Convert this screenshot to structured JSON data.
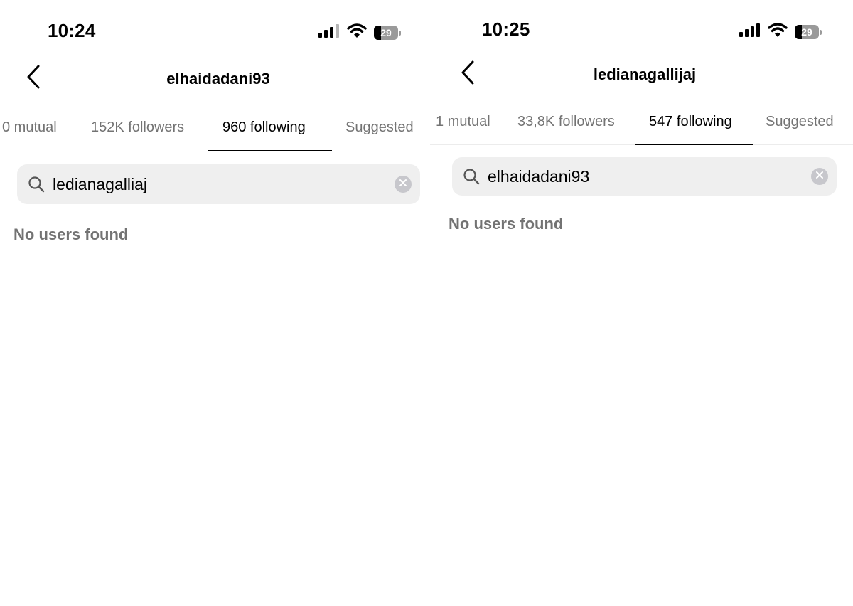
{
  "left": {
    "status": {
      "time": "10:24",
      "battery": "29",
      "battery_level": 0.29
    },
    "header": {
      "title": "elhaidadani93"
    },
    "tabs": [
      {
        "label": "0 mutual"
      },
      {
        "label": "152K followers"
      },
      {
        "label": "960 following",
        "active": true
      },
      {
        "label": "Suggested"
      }
    ],
    "search": {
      "value": "ledianagalliaj",
      "placeholder": "Search"
    },
    "empty_message": "No users found"
  },
  "right": {
    "status": {
      "time": "10:25",
      "battery": "29",
      "battery_level": 0.29
    },
    "header": {
      "title": "ledianagallijaj"
    },
    "tabs": [
      {
        "label": "1 mutual"
      },
      {
        "label": "33,8K followers"
      },
      {
        "label": "547 following",
        "active": true
      },
      {
        "label": "Suggested"
      }
    ],
    "search": {
      "value": "elhaidadani93",
      "placeholder": "Search"
    },
    "empty_message": "No users found"
  },
  "icons": {
    "back": "chevron-left-icon",
    "signal": "cellular-signal-icon",
    "wifi": "wifi-icon",
    "battery": "battery-icon",
    "search": "search-icon",
    "clear": "clear-circle-icon"
  },
  "colors": {
    "text_primary": "#000000",
    "text_secondary": "#737373",
    "search_bg": "#efefef",
    "clear_btn": "#c7c7cc",
    "divider": "#ececec"
  }
}
